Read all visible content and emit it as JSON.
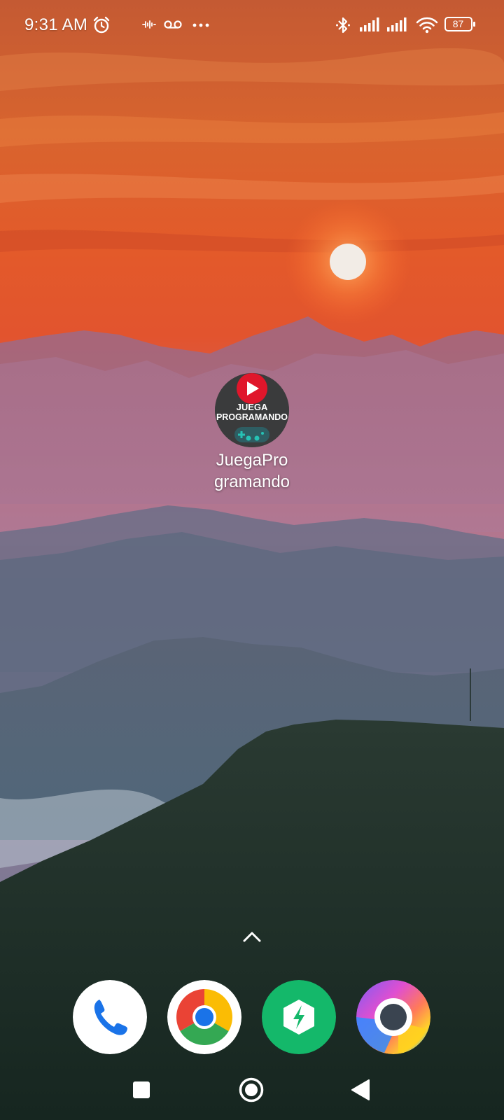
{
  "status_bar": {
    "time": "9:31 AM",
    "battery_level": "87",
    "icons": [
      "alarm-icon",
      "activity-icon",
      "voicemail-icon",
      "more-dots-icon",
      "bluetooth-icon",
      "signal-icon",
      "signal-icon",
      "wifi-icon",
      "battery-icon"
    ]
  },
  "home_screen": {
    "app": {
      "label_line1": "JuegaPro",
      "label_line2": "gramando",
      "icon_text_line1": "JUEGA",
      "icon_text_line2": "PROGRAMANDO"
    },
    "swipe_up_icon": "chevron-up-icon"
  },
  "dock": {
    "apps": [
      {
        "name": "phone-app",
        "icon": "phone-icon"
      },
      {
        "name": "chrome-app",
        "icon": "chrome-icon"
      },
      {
        "name": "hexagon-bolt-app",
        "icon": "bolt-hexagon-icon"
      },
      {
        "name": "browser-app",
        "icon": "browser-ring-icon"
      }
    ]
  },
  "nav_bar": {
    "buttons": [
      "recents-button",
      "home-button",
      "back-button"
    ]
  },
  "colors": {
    "sky_top": "#c6532d",
    "sky_mid": "#e2542e",
    "sun": "#f2ece6",
    "mountain_far": "#8a6f8e",
    "mountain_mid": "#6c6e86",
    "forest": "#1f3129",
    "hex_green": "#14b86a",
    "phone_blue": "#1a73e8"
  }
}
